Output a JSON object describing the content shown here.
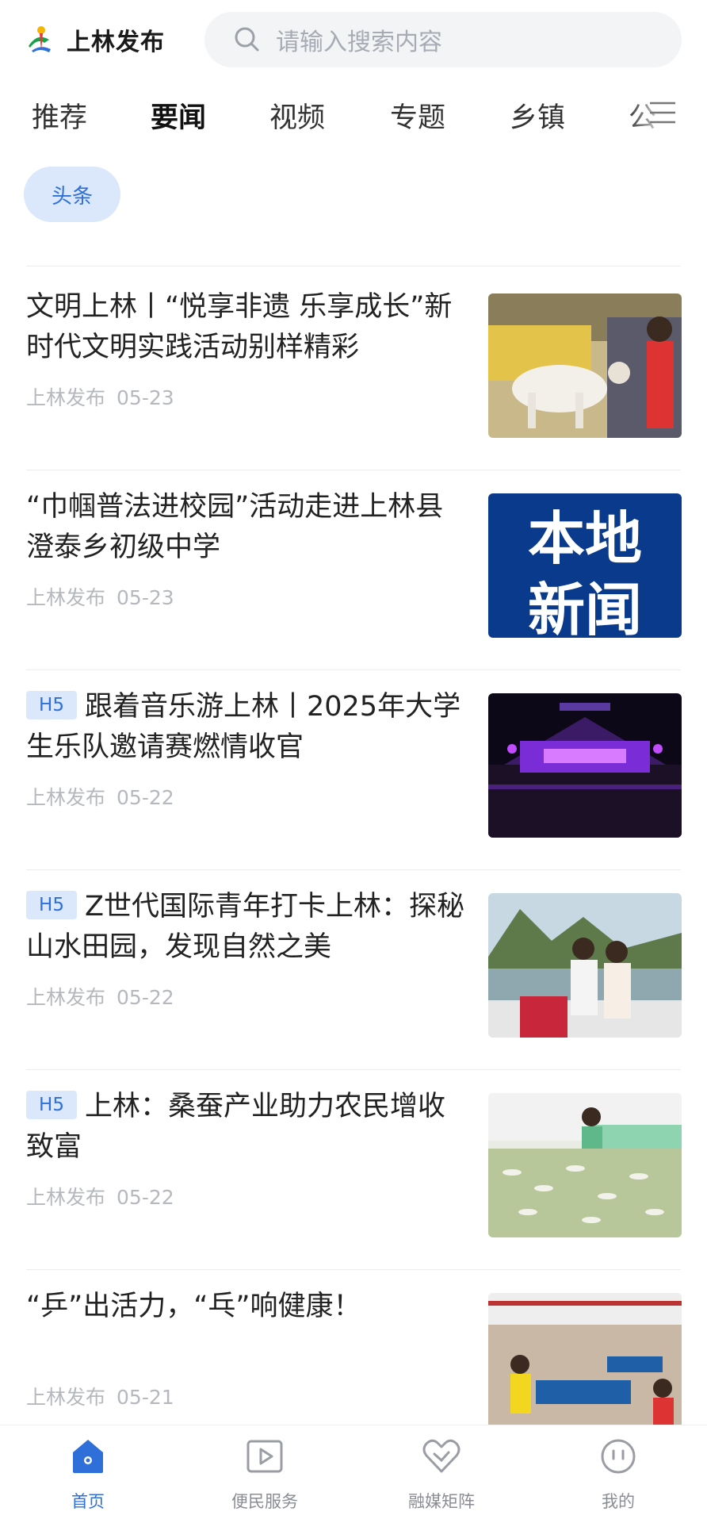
{
  "header": {
    "app_name": "上林发布",
    "search_placeholder": "请输入搜索内容"
  },
  "channels": [
    "推荐",
    "要闻",
    "视频",
    "专题",
    "乡镇",
    "公"
  ],
  "active_channel": "要闻",
  "sub_tab": "头条",
  "news": [
    {
      "title": "文明上林丨“悦享非遗 乐享成长”新时代文明实践活动别样精彩",
      "source": "上林发布",
      "date": "05-23",
      "badge": ""
    },
    {
      "title": "“巾帼普法进校园”活动走进上林县澄泰乡初级中学",
      "source": "上林发布",
      "date": "05-23",
      "badge": "",
      "thumb_text_1": "本地",
      "thumb_text_2": "新闻"
    },
    {
      "title": "跟着音乐游上林丨2025年大学生乐队邀请赛燃情收官",
      "source": "上林发布",
      "date": "05-22",
      "badge": "H5"
    },
    {
      "title": "Z世代国际青年打卡上林：探秘山水田园，发现自然之美",
      "source": "上林发布",
      "date": "05-22",
      "badge": "H5"
    },
    {
      "title": "上林：桑蚕产业助力农民增收致富",
      "source": "上林发布",
      "date": "05-22",
      "badge": "H5"
    },
    {
      "title": "“乒”出活力，“乓”响健康！",
      "source": "上林发布",
      "date": "05-21",
      "badge": ""
    }
  ],
  "bottom_nav": [
    {
      "label": "首页",
      "icon": "home-icon",
      "active": true
    },
    {
      "label": "便民服务",
      "icon": "play-icon",
      "active": false
    },
    {
      "label": "融媒矩阵",
      "icon": "heart-icon",
      "active": false
    },
    {
      "label": "我的",
      "icon": "smiley-icon",
      "active": false
    }
  ],
  "colors": {
    "accent": "#2e6fd9",
    "badge_bg": "#dbe8fb",
    "meta": "#b5b8bd"
  }
}
